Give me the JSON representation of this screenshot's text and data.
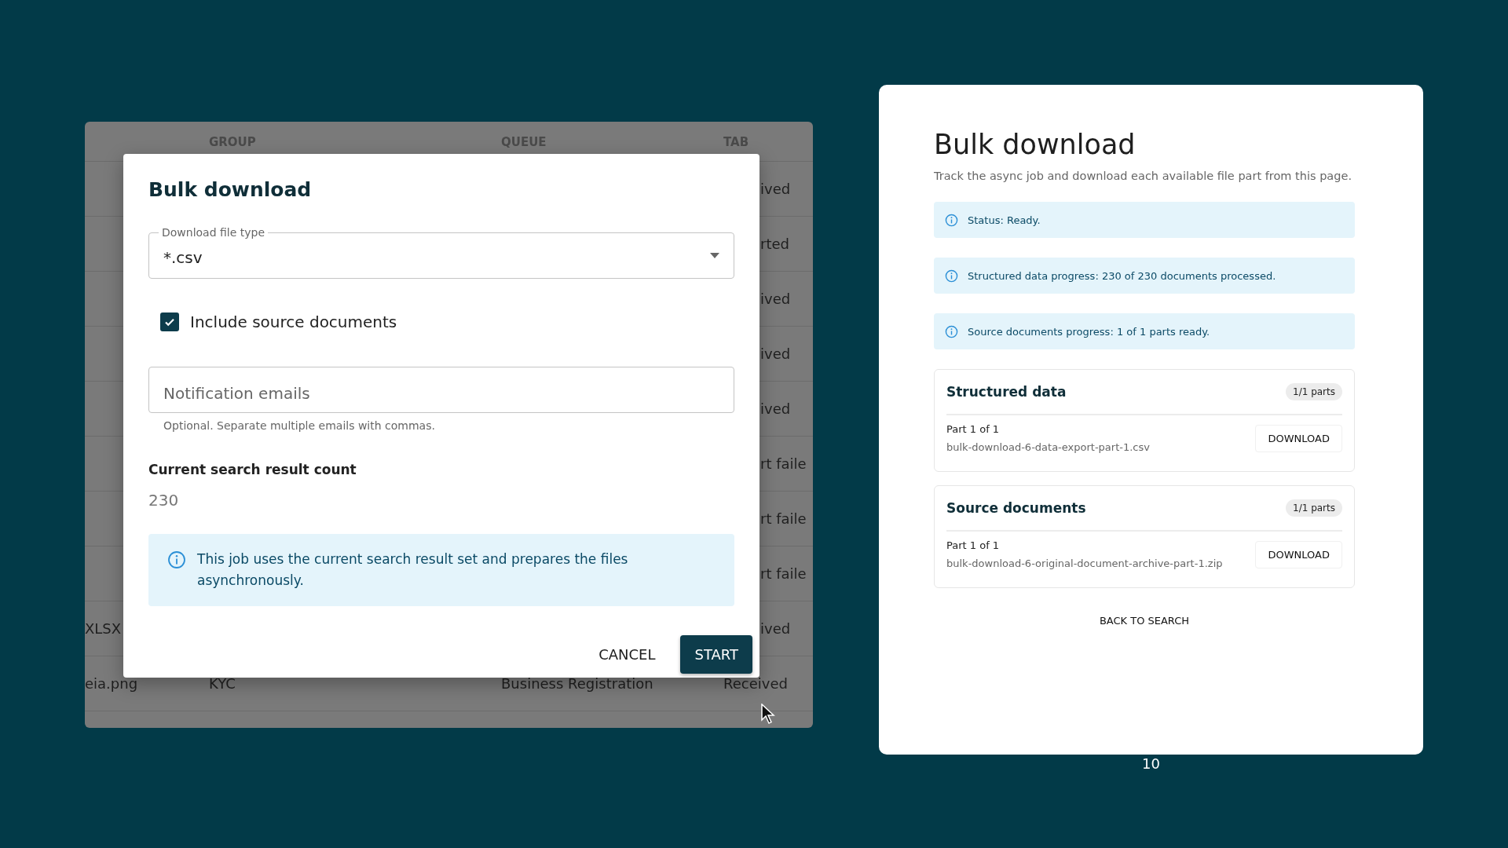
{
  "table": {
    "columns": [
      "GROUP",
      "QUEUE",
      "TAB"
    ],
    "rows": [
      {
        "tab": "ived"
      },
      {
        "tab": "rted"
      },
      {
        "tab": "ived"
      },
      {
        "tab": "ived"
      },
      {
        "tab": "ived"
      },
      {
        "tab": "rt faile"
      },
      {
        "tab": "rt faile"
      },
      {
        "tab": "rt faile"
      },
      {
        "column_1": "XLSX",
        "tab": "ived"
      },
      {
        "column_1": "eia.png",
        "group": "KYC",
        "queue": "Business Registration",
        "tab": "Received"
      }
    ]
  },
  "dialog": {
    "title": "Bulk download",
    "file_type": {
      "label": "Download file type",
      "value": "*.csv"
    },
    "include_source": {
      "label": "Include source documents",
      "checked": true
    },
    "emails": {
      "placeholder": "Notification emails",
      "helper": "Optional. Separate multiple emails with commas."
    },
    "count": {
      "label": "Current search result count",
      "value": "230"
    },
    "info": "This job uses the current search result set and prepares the files asynchronously.",
    "buttons": [
      {
        "label": "CANCEL",
        "kind": "text"
      },
      {
        "label": "START",
        "kind": "primary"
      }
    ]
  },
  "page": {
    "title": "Bulk download",
    "subtitle": "Track the async job and download each available file part from this page.",
    "alerts": [
      "Status: Ready.",
      "Structured data progress: 230 of 230 documents processed.",
      "Source documents progress: 1 of 1 parts ready."
    ],
    "sections": [
      {
        "title": "Structured data",
        "badge": "1/1 parts",
        "parts": [
          {
            "label": "Part 1 of 1",
            "file": "bulk-download-6-data-export-part-1.csv",
            "button": "DOWNLOAD"
          }
        ]
      },
      {
        "title": "Source documents",
        "badge": "1/1 parts",
        "parts": [
          {
            "label": "Part 1 of 1",
            "file": "bulk-download-6-original-document-archive-part-1.zip",
            "button": "DOWNLOAD"
          }
        ]
      }
    ],
    "back_link": "BACK TO SEARCH"
  },
  "page_number": "10"
}
